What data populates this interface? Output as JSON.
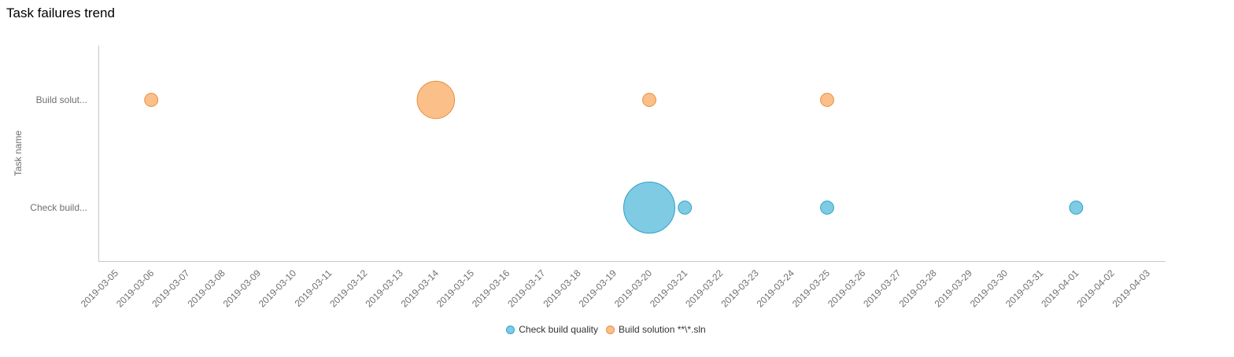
{
  "title": "Task failures trend",
  "chart_data": {
    "type": "scatter",
    "xlabel": "",
    "ylabel": "Task name",
    "x_ticks": [
      "2019-03-05",
      "2019-03-06",
      "2019-03-07",
      "2019-03-08",
      "2019-03-09",
      "2019-03-10",
      "2019-03-11",
      "2019-03-12",
      "2019-03-13",
      "2019-03-14",
      "2019-03-15",
      "2019-03-16",
      "2019-03-17",
      "2019-03-18",
      "2019-03-19",
      "2019-03-20",
      "2019-03-21",
      "2019-03-22",
      "2019-03-23",
      "2019-03-24",
      "2019-03-25",
      "2019-03-26",
      "2019-03-27",
      "2019-03-28",
      "2019-03-29",
      "2019-03-30",
      "2019-03-31",
      "2019-04-01",
      "2019-04-02",
      "2019-04-03"
    ],
    "y_categories": [
      "Build solut...",
      "Check build..."
    ],
    "grid": false,
    "legend_position": "bottom",
    "series": [
      {
        "name": "Check build quality",
        "color": "#7ecbe3",
        "stroke": "#2ea3c9",
        "category": "Check build...",
        "points": [
          {
            "x": "2019-03-20",
            "size": 15
          },
          {
            "x": "2019-03-21",
            "size": 1
          },
          {
            "x": "2019-03-25",
            "size": 1
          },
          {
            "x": "2019-04-01",
            "size": 1
          }
        ]
      },
      {
        "name": "Build solution **\\*.sln",
        "color": "#fbbf8a",
        "stroke": "#e88f3c",
        "category": "Build solut...",
        "points": [
          {
            "x": "2019-03-06",
            "size": 1
          },
          {
            "x": "2019-03-14",
            "size": 8
          },
          {
            "x": "2019-03-20",
            "size": 1
          },
          {
            "x": "2019-03-25",
            "size": 1
          }
        ]
      }
    ]
  }
}
